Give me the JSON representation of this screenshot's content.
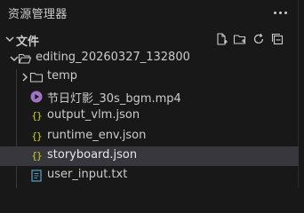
{
  "panel": {
    "title": "资源管理器",
    "more_icon": "more-horizontal-icon"
  },
  "section": {
    "title": "文件",
    "actions": [
      {
        "name": "new-file-icon"
      },
      {
        "name": "new-folder-icon"
      },
      {
        "name": "refresh-icon"
      },
      {
        "name": "collapse-all-icon"
      }
    ]
  },
  "tree": {
    "root": {
      "label": "editing_20260327_132800",
      "expanded": true
    },
    "items": [
      {
        "label": "temp",
        "type": "folder",
        "expanded": false
      },
      {
        "label": "节日灯影_30s_bgm.mp4",
        "type": "video"
      },
      {
        "label": "output_vlm.json",
        "type": "json"
      },
      {
        "label": "runtime_env.json",
        "type": "json"
      },
      {
        "label": "storyboard.json",
        "type": "json",
        "selected": true
      },
      {
        "label": "user_input.txt",
        "type": "text"
      }
    ]
  },
  "colors": {
    "background": "#181818",
    "selected_row": "#37373d",
    "json_icon": "#cbcb41",
    "video_icon": "#a074c4",
    "text_icon": "#519aba"
  }
}
